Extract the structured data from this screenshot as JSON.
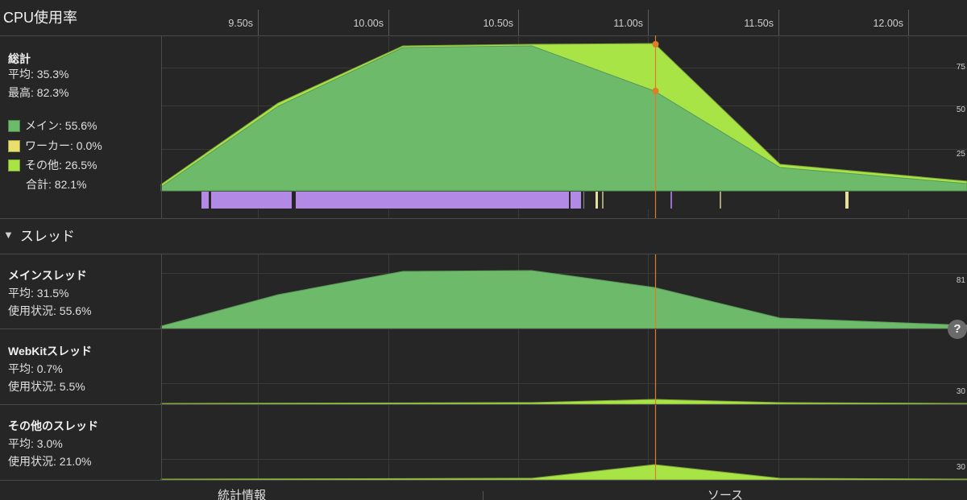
{
  "header": {
    "title": "CPU使用率",
    "ticks": [
      "9.50s",
      "10.00s",
      "10.50s",
      "11.00s",
      "11.50s",
      "12.00s"
    ]
  },
  "summary": {
    "title": "総計",
    "avg": "平均: 35.3%",
    "peak": "最高: 82.3%",
    "legend": [
      {
        "label": "メイン: 55.6%",
        "color": "#6dba6a"
      },
      {
        "label": "ワーカー: 0.0%",
        "color": "#e8df6c"
      },
      {
        "label": "その他: 26.5%",
        "color": "#a9e446"
      }
    ],
    "total": "合計: 82.1%",
    "axis": [
      "75",
      "50",
      "25"
    ]
  },
  "threads_section": {
    "title": "スレッド",
    "triangle": "▼"
  },
  "threads": [
    {
      "name": "メインスレッド",
      "avg": "平均: 31.5%",
      "usage": "使用状況: 55.6%",
      "axis_max": "81"
    },
    {
      "name": "WebKitスレッド",
      "avg": "平均: 0.7%",
      "usage": "使用状況: 5.5%",
      "axis_max": "30"
    },
    {
      "name": "その他のスレッド",
      "avg": "平均: 3.0%",
      "usage": "使用状況: 21.0%",
      "axis_max": "30"
    }
  ],
  "help_button": "?",
  "bottom_tabs": [
    "統計情報",
    "ソース"
  ],
  "colors": {
    "main": "#6dba6a",
    "worker": "#e8df6c",
    "other": "#a9e446",
    "marker": "#e07b2a",
    "script_bar": "#b28ae6"
  }
}
